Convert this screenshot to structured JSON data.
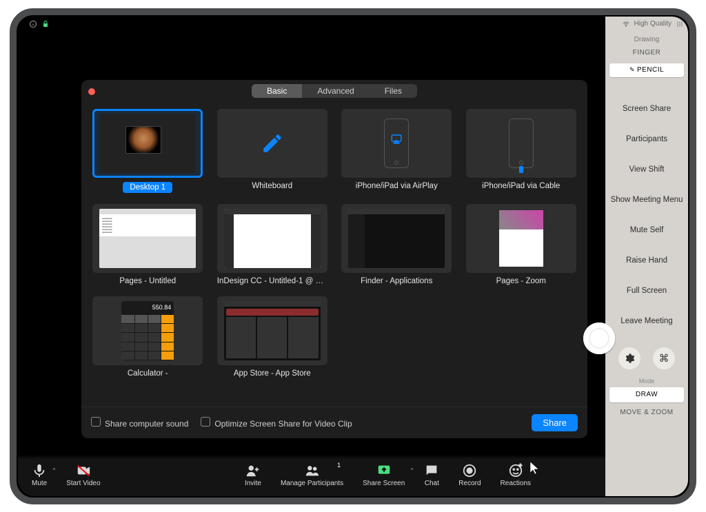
{
  "status": {
    "quality": "High Quality"
  },
  "share": {
    "tabs": {
      "basic": "Basic",
      "advanced": "Advanced",
      "files": "Files"
    },
    "tiles": [
      {
        "label": "Desktop 1",
        "selected": true,
        "kind": "desktop"
      },
      {
        "label": "Whiteboard",
        "kind": "whiteboard"
      },
      {
        "label": "iPhone/iPad via AirPlay",
        "kind": "airplay"
      },
      {
        "label": "iPhone/iPad via Cable",
        "kind": "cable"
      },
      {
        "label": "Pages - Untitled",
        "kind": "doc"
      },
      {
        "label": "InDesign CC - Untitled-1 @ 54% [...",
        "kind": "indesign"
      },
      {
        "label": "Finder - Applications",
        "kind": "finder"
      },
      {
        "label": "Pages - Zoom",
        "kind": "doc2"
      },
      {
        "label": "Calculator -",
        "kind": "calc",
        "calc_value": "550.84"
      },
      {
        "label": "App Store - App Store",
        "kind": "appstore"
      }
    ],
    "opt_sound": "Share computer sound",
    "opt_optimize": "Optimize Screen Share for Video Clip",
    "share_button": "Share"
  },
  "toolbar": {
    "mute": "Mute",
    "start_video": "Start Video",
    "invite": "Invite",
    "manage_participants": "Manage Participants",
    "participants_count": "1",
    "share_screen": "Share Screen",
    "chat": "Chat",
    "record": "Record",
    "reactions": "Reactions"
  },
  "sidebar": {
    "drawing_label": "Drawing",
    "finger": "FINGER",
    "pencil": "PENCIL",
    "items": [
      "Screen Share",
      "Participants",
      "View Shift",
      "Show Meeting Menu",
      "Mute Self",
      "Raise Hand",
      "Full Screen",
      "Leave Meeting"
    ],
    "mode_label": "Mode",
    "draw": "DRAW",
    "move_zoom": "MOVE & ZOOM"
  }
}
